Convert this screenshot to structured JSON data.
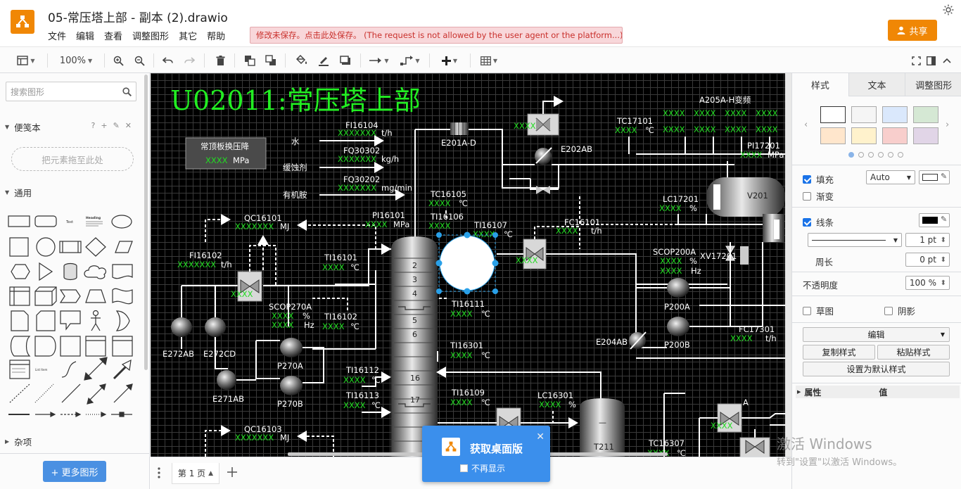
{
  "header": {
    "title": "05-常压塔上部 - 副本 (2).drawio",
    "menu": [
      "文件",
      "编辑",
      "查看",
      "调整图形",
      "其它",
      "帮助"
    ],
    "unsaved_message": "修改未保存。点击此处保存。 (The request is not allowed by the user agent or the platform...)",
    "share_label": "共享"
  },
  "toolbar": {
    "zoom": "100%"
  },
  "left_panel": {
    "search_placeholder": "搜索图形",
    "scratchpad_title": "便笺本",
    "scratchpad_tools": [
      "?",
      "+",
      "✎",
      "✕"
    ],
    "drop_zone": "把元素拖至此处",
    "general_title": "通用",
    "misc_title": "杂项",
    "more_shapes": "+ 更多图形",
    "shape_text_label": "Text",
    "shape_heading_label": "Heading"
  },
  "canvas": {
    "main_title": "U02011:常压塔上部",
    "panel_title": "常顶板换压降",
    "placeholder": "XXXX",
    "placeholder_long": "XXXXXXX",
    "unit_mpa": "MPa",
    "unit_th": "t/h",
    "unit_kgh": "kg/h",
    "unit_mgmin": "mg/min",
    "unit_c": "℃",
    "unit_pct": "%",
    "unit_hz": "Hz",
    "unit_mj": "MJ",
    "labels": {
      "water": "水",
      "corrosion": "缓蚀剂",
      "amine": "有机胺",
      "fi16104": "FI16104",
      "fq30302": "FQ30302",
      "fq30202": "FQ30202",
      "e201ad": "E201A-D",
      "e202ab": "E202AB",
      "tc17101": "TC17101",
      "a205ah": "A205A-H变频",
      "pi17201": "PI17201",
      "v201": "V201",
      "lc17201": "LC17201",
      "tc16105": "TC16105",
      "qc16101": "QC16101",
      "pi16101": "PI16101",
      "ti16106": "TI16106",
      "ti16107": "TI16107",
      "fc16101": "FC16101",
      "fi16102": "FI16102",
      "ti16101": "TI16101",
      "scop200a": "SCOP200A",
      "xv17201": "XV17201",
      "scop270a": "SCOP270A",
      "ti16102": "TI16102",
      "ti16111": "TI16111",
      "p200a": "P200A",
      "e272ab": "E272AB",
      "e272cd": "E272CD",
      "p270a": "P270A",
      "ti16301": "TI16301",
      "e204ab": "E204AB",
      "p200b": "P200B",
      "fc17301": "FC17301",
      "e271ab": "E271AB",
      "ti16112": "TI16112",
      "p270b": "P270B",
      "ti16113": "TI16113",
      "ti16109": "TI16109",
      "lc16301": "LC16301",
      "qc16103": "QC16103",
      "t211": "T211",
      "tc16307": "TC16307",
      "a": "A"
    },
    "tray_numbers": [
      "2",
      "3",
      "4",
      "5",
      "6",
      "16",
      "17"
    ]
  },
  "bottom": {
    "page_tab": "第 1 页"
  },
  "right_panel": {
    "tabs": [
      "样式",
      "文本",
      "调整图形"
    ],
    "swatch_colors": [
      "#ffffff",
      "#f5f5f5",
      "#dae8fc",
      "#d5e8d4",
      "#ffe6cc",
      "#fff2cc",
      "#f8cecc",
      "#e1d5e7"
    ],
    "fill_label": "填充",
    "fill_value": "Auto",
    "gradient_label": "渐变",
    "line_label": "线条",
    "line_width": "1 pt",
    "perimeter_label": "周长",
    "perimeter_value": "0 pt",
    "opacity_label": "不透明度",
    "opacity_value": "100 %",
    "sketch_label": "草图",
    "shadow_label": "阴影",
    "edit_label": "编辑",
    "copy_style": "复制样式",
    "paste_style": "粘贴样式",
    "set_default": "设置为默认样式",
    "prop_header": "属性",
    "value_header": "值"
  },
  "popup": {
    "title": "获取桌面版",
    "dont_show": "不再显示"
  },
  "watermark": {
    "line1": "激活 Windows",
    "line2": "转到\"设置\"以激活 Windows。"
  },
  "colors": {
    "accent": "#f08705",
    "canvas_bg": "#000000",
    "value_green": "#22dd22",
    "popup_blue": "#3b8fec",
    "selection": "#29a0e8"
  }
}
